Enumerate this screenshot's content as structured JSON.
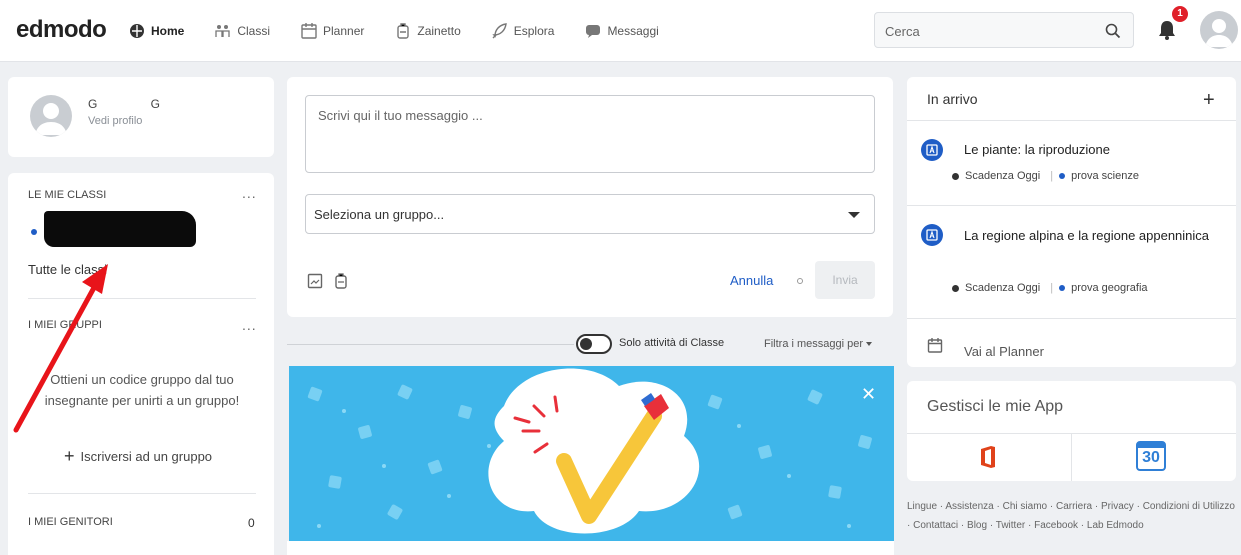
{
  "nav": {
    "logo": "edmodo",
    "items": [
      {
        "label": "Home",
        "icon": "home-icon"
      },
      {
        "label": "Classi",
        "icon": "classes-icon"
      },
      {
        "label": "Planner",
        "icon": "planner-icon"
      },
      {
        "label": "Zainetto",
        "icon": "backpack-icon"
      },
      {
        "label": "Esplora",
        "icon": "rocket-icon"
      },
      {
        "label": "Messaggi",
        "icon": "chat-icon"
      }
    ],
    "search_placeholder": "Cerca",
    "notifications_count": "1"
  },
  "profile": {
    "name": "G G",
    "link": "Vedi profilo"
  },
  "classes": {
    "title": "LE MIE CLASSI",
    "more": "...",
    "all_classes": "Tutte le classi"
  },
  "groups": {
    "title": "I MIEI GRUPPI",
    "more": "...",
    "text": "Ottieni un codice gruppo dal tuo insegnante per unirti a un gruppo!",
    "join": "Iscriversi ad un gruppo"
  },
  "parents": {
    "title": "I MIEI GENITORI",
    "count": "0"
  },
  "composer": {
    "placeholder": "Scrivi qui il tuo messaggio ...",
    "group_select": "Seleziona un gruppo...",
    "cancel": "Annulla",
    "send": "Invia"
  },
  "feed_filter": {
    "toggle_label": "Solo attività di Classe",
    "filter_label": "Filtra i messaggi per"
  },
  "inbox": {
    "title": "In arrivo",
    "tasks": [
      {
        "title": "Le piante: la riproduzione",
        "due": "Scadenza Oggi",
        "group": "prova scienze"
      },
      {
        "title": "La regione alpina e la regione appenninica",
        "due": "Scadenza Oggi",
        "group": "prova geografia"
      }
    ],
    "planner": "Vai al Planner"
  },
  "apps": {
    "title": "Gestisci le mie App",
    "calendar_day": "30",
    "colors": {
      "office": "#e0421a",
      "calendar": "#2f7fd6"
    }
  },
  "footer": {
    "links": [
      "Lingue",
      "Assistenza",
      "Chi siamo",
      "Carriera",
      "Privacy",
      "Condizioni di Utilizzo",
      "Contattaci",
      "Blog",
      "Twitter",
      "Facebook",
      "Lab Edmodo"
    ]
  },
  "colors": {
    "accent": "#1f5dc6",
    "badge": "#e0202a",
    "banner": "#3fb6ea",
    "annotation_arrow": "#e8141a"
  }
}
